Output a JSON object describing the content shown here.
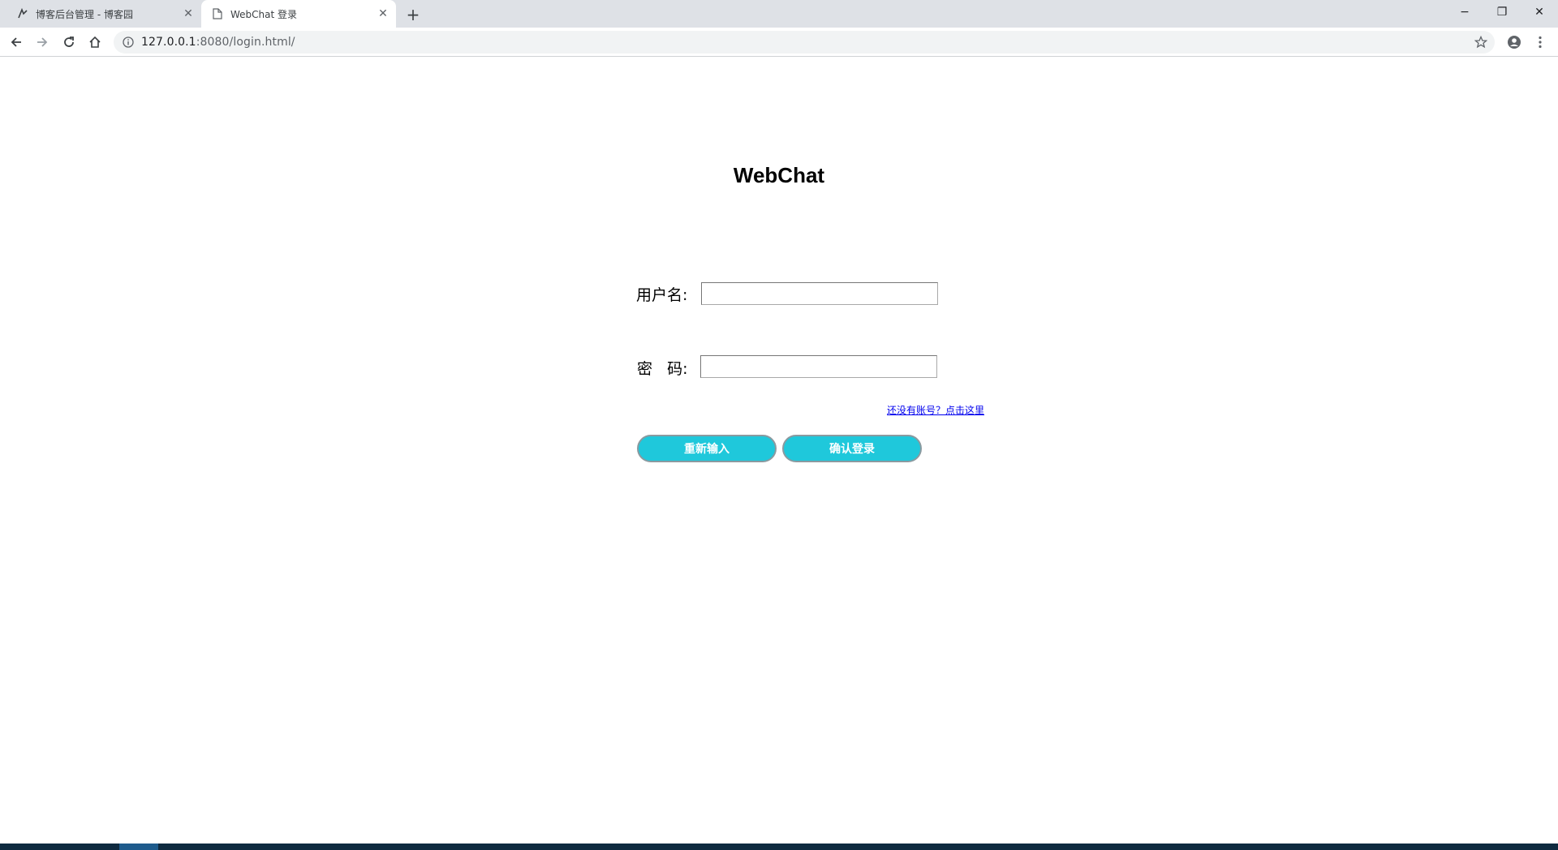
{
  "browser": {
    "tabs": [
      {
        "title": "博客后台管理 - 博客园",
        "icon": "cnblogs-icon",
        "active": false
      },
      {
        "title": "WebChat 登录",
        "icon": "page-icon",
        "active": true
      }
    ],
    "new_tab_label": "+",
    "window_controls": {
      "minimize": "−",
      "maximize": "❐",
      "close": "✕"
    },
    "url_host": "127.0.0.1",
    "url_rest": ":8080/login.html/"
  },
  "page": {
    "title": "WebChat",
    "username_label": "用户名:",
    "password_label": "密   码:",
    "username_value": "",
    "password_value": "",
    "register_link": "还没有账号？点击这里",
    "reset_button": "重新输入",
    "login_button": "确认登录"
  },
  "colors": {
    "button_fill": "#1fc8db",
    "link": "#0000ee",
    "tabstrip": "#dee1e6"
  }
}
